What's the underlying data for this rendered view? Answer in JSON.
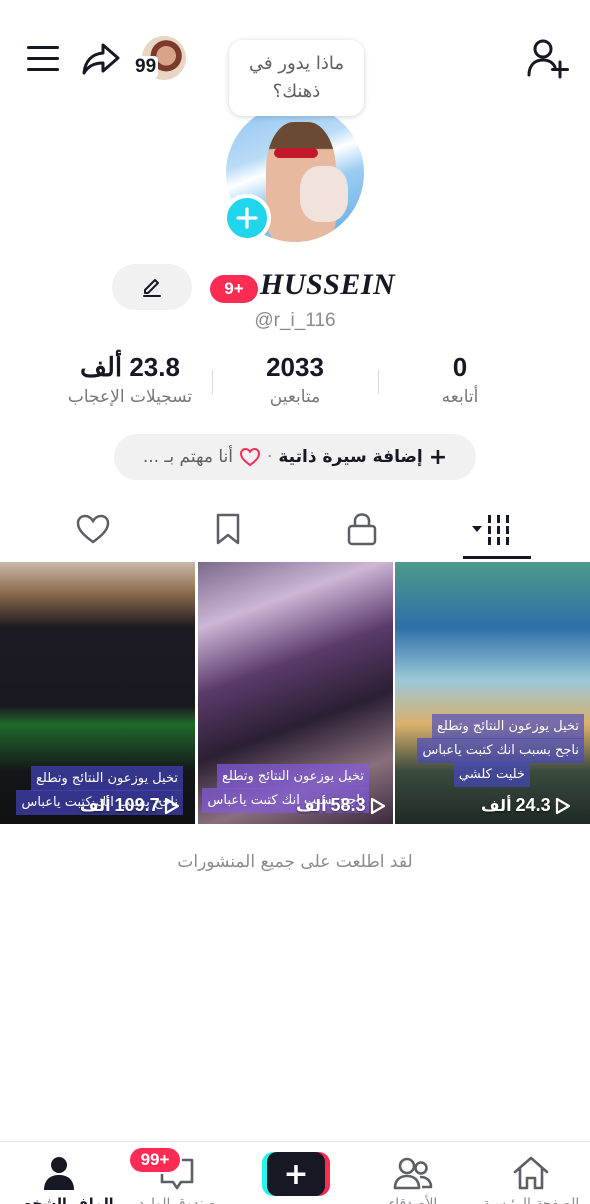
{
  "header": {
    "story_count": "99",
    "thought_bubble": "ماذا يدور في ذهنك؟"
  },
  "profile": {
    "display_name": "HUSSEIN",
    "name_badge": "9+",
    "username": "@r_i_116"
  },
  "stats": [
    {
      "value": "23.8 ألف",
      "label": "تسجيلات الإعجاب"
    },
    {
      "value": "2033",
      "label": "متابعين"
    },
    {
      "value": "0",
      "label": "أتابعه"
    }
  ],
  "bio": {
    "add_label": "إضافة سيرة ذاتية",
    "separator": "·",
    "interest_label": "أنا مهتم بـ ..."
  },
  "tabs": [
    {
      "name": "videos",
      "icon": "grid-icon"
    },
    {
      "name": "private",
      "icon": "lock-icon"
    },
    {
      "name": "saved",
      "icon": "bookmark-icon"
    },
    {
      "name": "liked",
      "icon": "heart-icon"
    }
  ],
  "videos": [
    {
      "views": "24.3",
      "unit": "ألف",
      "caption": [
        "تخيل يوزعون النتائج وتطلع",
        "ناجح بسبب انك كتبت ياعباس",
        "خليت كلشي"
      ]
    },
    {
      "views": "58.3",
      "unit": "ألف",
      "caption": [
        "تخيل يوزعون النتائج وتطلع",
        "ناجح بسبب انك كتبت ياعباس"
      ]
    },
    {
      "views": "109.7",
      "unit": "ألف",
      "caption": [
        "تخيل يوزعون النتائج وتطلع",
        "ناجح بسبب انك كتبت ياعباس"
      ]
    }
  ],
  "footer_note": "لقد اطلعت على جميع المنشورات",
  "bottom_nav": {
    "home": "الصفحة الرئيسية",
    "friends": "الأصدقاء",
    "create": "+",
    "inbox": "صندوق الوارد",
    "inbox_badge": "99+",
    "profile": "الملف الشخصي"
  },
  "colors": {
    "accent_red": "#fe2c55",
    "accent_cyan": "#20d5ec",
    "text_primary": "#161823",
    "text_secondary": "#8a8b91"
  }
}
